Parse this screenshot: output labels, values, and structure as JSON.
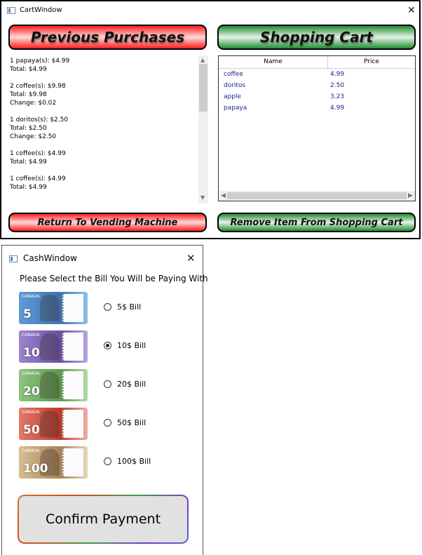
{
  "cart_window": {
    "title": "CartWindow",
    "close_glyph": "✕",
    "previous_purchases_label": "Previous Purchases",
    "shopping_cart_label": "Shopping Cart",
    "return_label": "Return To Vending Machine",
    "remove_label": "Remove Item From Shopping Cart",
    "purchases_text": "1 papaya(s): $4.99\nTotal: $4.99\n\n2 coffee(s): $9.98\nTotal: $9.98\nChange: $0.02\n\n1 doritos(s): $2.50\nTotal: $2.50\nChange: $2.50\n\n1 coffee(s): $4.99\nTotal: $4.99\n\n1 coffee(s): $4.99\nTotal: $4.99",
    "cart_columns": [
      "Name",
      "Price"
    ],
    "cart_rows": [
      {
        "name": "coffee",
        "price": "4.99"
      },
      {
        "name": "doritos",
        "price": "2.50"
      },
      {
        "name": "apple",
        "price": "3.23"
      },
      {
        "name": "papaya",
        "price": "4.99"
      }
    ],
    "colors": {
      "red_accent": "#ff1d1d",
      "green_accent": "#1f8d2f",
      "row_text": "#1a1f8a"
    }
  },
  "cash_window": {
    "title": "CashWindow",
    "close_glyph": "✕",
    "prompt": "Please Select the Bill You Will be Paying With",
    "bills": [
      {
        "label": "5$ Bill",
        "numeral": "5",
        "checked": false,
        "color": "#4f87c4"
      },
      {
        "label": "10$ Bill",
        "numeral": "10",
        "checked": true,
        "color": "#7a5fb0"
      },
      {
        "label": "20$ Bill",
        "numeral": "20",
        "checked": false,
        "color": "#5f9e58"
      },
      {
        "label": "50$ Bill",
        "numeral": "50",
        "checked": false,
        "color": "#c84a3a"
      },
      {
        "label": "100$ Bill",
        "numeral": "100",
        "checked": false,
        "color": "#b8956a"
      }
    ],
    "confirm_label": "Confirm Payment"
  },
  "icons": {
    "window_icon": "window-icon",
    "close": "close-icon",
    "scroll_up": "▲",
    "scroll_down": "▼",
    "scroll_left": "◀",
    "scroll_right": "▶"
  }
}
